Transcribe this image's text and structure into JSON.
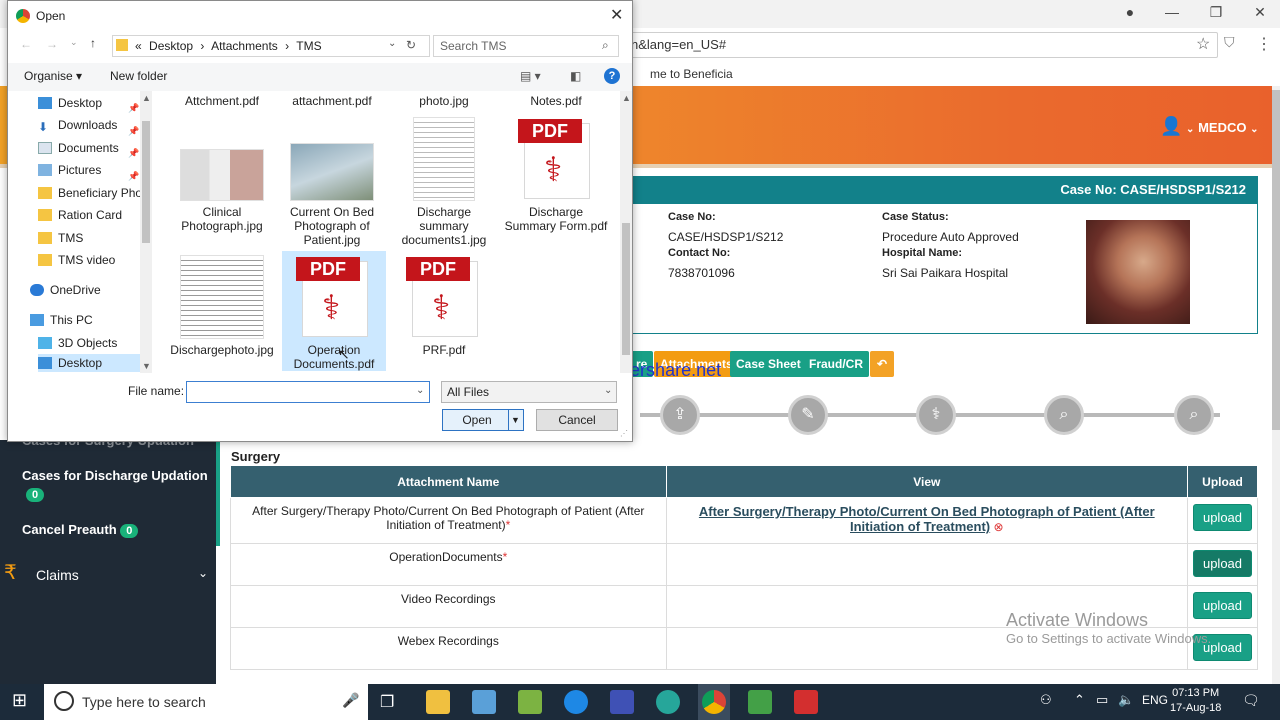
{
  "browser": {
    "address_partial": "n&lang=en_US#",
    "bookmark_partial": "me to Beneficia",
    "minimize": "—",
    "restore": "❐",
    "close": "✕"
  },
  "app": {
    "user_label": "MEDCO",
    "case_header": "Case No: CASE/HSDSP1/S212",
    "case_no_label": "Case No:",
    "case_no_value": "CASE/HSDSP1/S212",
    "case_status_label": "Case Status:",
    "case_status_value": "Procedure Auto Approved",
    "contact_label": "Contact No:",
    "contact_value": "7838701096",
    "hospital_label": "Hospital Name:",
    "hospital_value": "Sri Sai Paikara Hospital",
    "tabs": [
      {
        "label": "re",
        "color": "#19a086"
      },
      {
        "label": "Attachments",
        "color": "#f39c12"
      },
      {
        "label": "Case Sheet",
        "color": "#19a086"
      },
      {
        "label": "Fraud/CR",
        "color": "#19a086"
      }
    ],
    "surgery_title": "Surgery",
    "table": {
      "headers": [
        "Attachment Name",
        "View",
        "Upload"
      ],
      "rows": [
        {
          "name": "After Surgery/Therapy Photo/Current On Bed Photograph of Patient (After Initiation of Treatment)",
          "required": "*",
          "view": "After Surgery/Therapy Photo/Current On Bed Photograph of Patient (After Initiation of Treatment)",
          "upload": "upload"
        },
        {
          "name": "OperationDocuments",
          "required": "*",
          "view": "",
          "upload": "upload"
        },
        {
          "name": "Video Recordings",
          "required": "",
          "view": "",
          "upload": "upload"
        },
        {
          "name": "Webex Recordings",
          "required": "",
          "view": "",
          "upload": "upload"
        }
      ]
    }
  },
  "sidebar": {
    "partial_item": "Cases for Surgery Updation",
    "items": [
      {
        "label": "Cases for Discharge Updation",
        "count": "0"
      },
      {
        "label": "Cancel Preauth",
        "count": "0"
      },
      {
        "label": "Claims",
        "count": ""
      }
    ]
  },
  "watermarks": {
    "thundershare": "www.thundershare.net",
    "activate_title": "Activate Windows",
    "activate_sub": "Go to Settings to activate Windows."
  },
  "taskbar": {
    "search_placeholder": "Type here to search",
    "lang": "ENG",
    "time": "07:13 PM",
    "date": "17-Aug-18"
  },
  "dialog": {
    "title": "Open",
    "path": [
      "«",
      "Desktop",
      "Attachments",
      "TMS"
    ],
    "search_placeholder": "Search TMS",
    "organise": "Organise ▾",
    "new_folder": "New folder",
    "nav_items": [
      {
        "label": "Desktop",
        "icon": "desktop-icon",
        "pinned": true
      },
      {
        "label": "Downloads",
        "icon": "download-icon",
        "pinned": true
      },
      {
        "label": "Documents",
        "icon": "documents-icon",
        "pinned": true
      },
      {
        "label": "Pictures",
        "icon": "pictures-icon",
        "pinned": true
      },
      {
        "label": "Beneficiary Phot",
        "icon": "folder-icon",
        "pinned": false
      },
      {
        "label": "Ration Card",
        "icon": "folder-icon",
        "pinned": false
      },
      {
        "label": "TMS",
        "icon": "folder-icon",
        "pinned": false
      },
      {
        "label": "TMS video",
        "icon": "folder-icon",
        "pinned": false
      },
      {
        "label": "OneDrive",
        "icon": "cloud-icon",
        "pinned": false
      },
      {
        "label": "This PC",
        "icon": "computer-icon",
        "pinned": false
      },
      {
        "label": "3D Objects",
        "icon": "cube-icon",
        "pinned": false
      },
      {
        "label": "Desktop",
        "icon": "desktop-icon",
        "pinned": false
      }
    ],
    "top_row_files": [
      "Attchment.pdf",
      "attachment.pdf",
      "photo.jpg",
      "Notes.pdf"
    ],
    "files": [
      {
        "name": "Clinical Photograph.jpg",
        "kind": "image"
      },
      {
        "name": "Current On Bed Photograph of Patient.jpg",
        "kind": "image"
      },
      {
        "name": "Discharge summary documents1.jpg",
        "kind": "doc"
      },
      {
        "name": "Discharge Summary Form.pdf",
        "kind": "pdf"
      },
      {
        "name": "Dischargephoto.jpg",
        "kind": "doc"
      },
      {
        "name": "Operation Documents.pdf",
        "kind": "pdf"
      },
      {
        "name": "PRF.pdf",
        "kind": "pdf"
      }
    ],
    "pdf_badge": "PDF",
    "file_name_label": "File name:",
    "file_name_value": "",
    "file_type": "All Files",
    "open_label": "Open",
    "cancel_label": "Cancel"
  }
}
